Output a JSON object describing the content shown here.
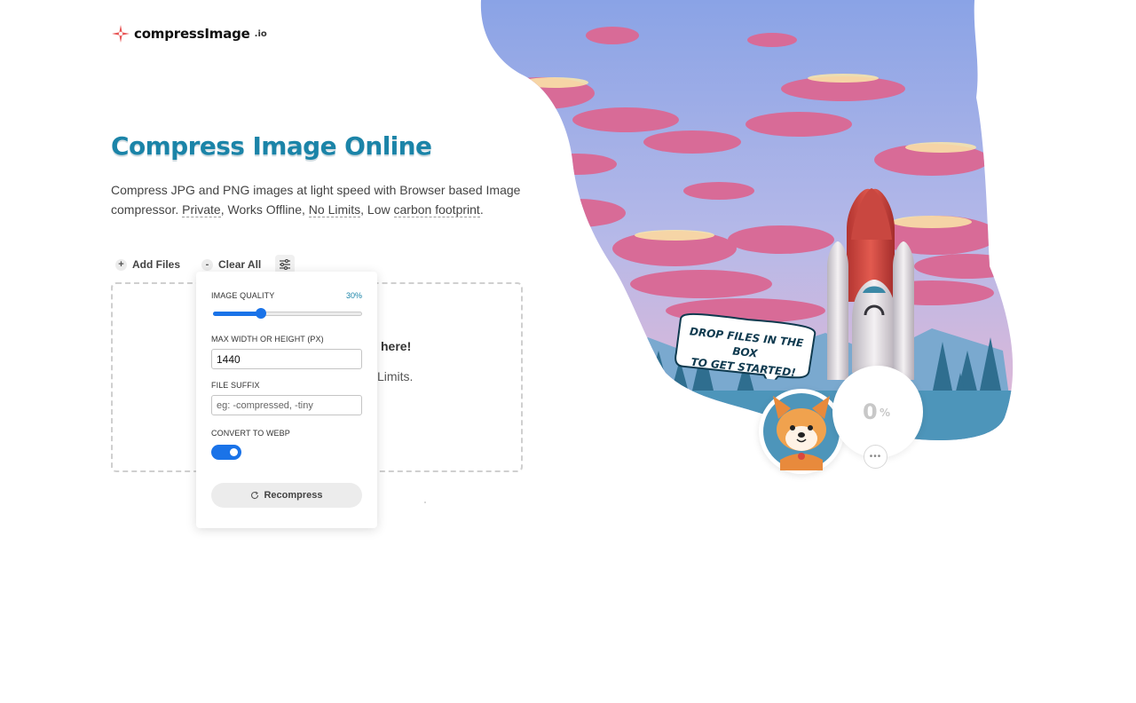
{
  "brand": {
    "name": "compressImage",
    "tld": ".io",
    "logo_icon": "sparkle-star-icon",
    "logo_color": "#e85555"
  },
  "hero": {
    "title": "Compress Image Online",
    "description_start": "Compress JPG and PNG images at light speed with Browser based Image compressor. ",
    "private": "Private",
    "sep1": ", Works Offline, ",
    "no_limits": "No Limits",
    "sep2": ", Low ",
    "carbon": "carbon footprint",
    "end": "."
  },
  "toolbar": {
    "add_files": "Add Files",
    "add_icon": "+",
    "clear_all": "Clear All",
    "clear_icon": "-",
    "settings_icon": "sliders-icon"
  },
  "dropzone": {
    "title_visible": "here!",
    "subtitle_visible": "Limits."
  },
  "settings": {
    "quality_label": "IMAGE QUALITY",
    "quality_value": "30%",
    "quality_fraction": 0.32,
    "max_label": "MAX WIDTH OR HEIGHT (PX)",
    "max_value": "1440",
    "suffix_label": "FILE SUFFIX",
    "suffix_placeholder": "eg: -compressed, -tiny",
    "webp_label": "CONVERT TO WEBP",
    "webp_enabled": true,
    "recompress_label": "Recompress",
    "recompress_icon": "refresh-icon"
  },
  "illustration": {
    "bubble_line1": "DROP FILES IN THE BOX",
    "bubble_line2": "TO GET STARTED!",
    "progress_number": "0",
    "progress_sign": "%",
    "more_label": "•••"
  },
  "colors": {
    "accent": "#1a73e8",
    "title": "#1b84a8",
    "sky_top": "#8aa3e6",
    "sky_bottom": "#f1b7cf",
    "cloud": "#d86b97",
    "rocket": "#d9473f"
  }
}
